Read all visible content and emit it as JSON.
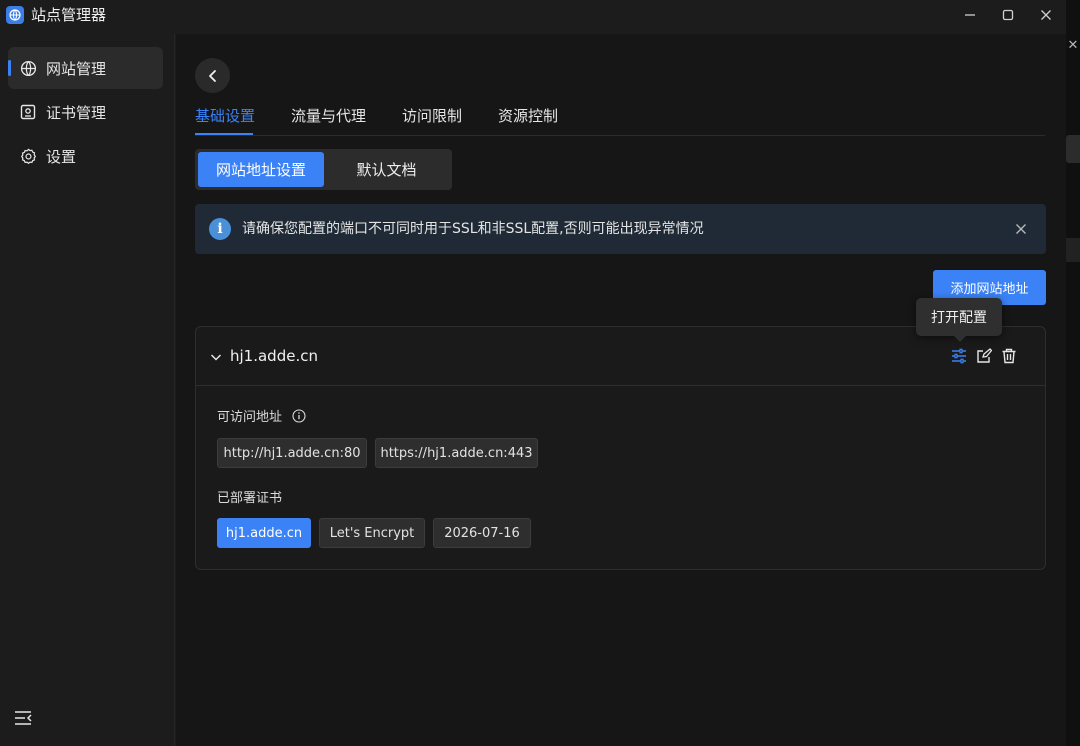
{
  "app": {
    "title": "站点管理器",
    "accent": "#3b82f6"
  },
  "window_controls": {
    "minimize": "minimize-icon",
    "maximize": "maximize-icon",
    "close": "close-icon"
  },
  "sidebar": {
    "items": [
      {
        "label": "网站管理",
        "icon": "globe-icon",
        "active": true
      },
      {
        "label": "证书管理",
        "icon": "certificate-icon",
        "active": false
      },
      {
        "label": "设置",
        "icon": "gear-icon",
        "active": false
      }
    ],
    "collapse_icon": "menu-collapse-icon"
  },
  "main": {
    "tabs": [
      {
        "label": "基础设置",
        "active": true
      },
      {
        "label": "流量与代理",
        "active": false
      },
      {
        "label": "访问限制",
        "active": false
      },
      {
        "label": "资源控制",
        "active": false
      }
    ],
    "segments": [
      {
        "label": "网站地址设置",
        "active": true
      },
      {
        "label": "默认文档",
        "active": false
      }
    ],
    "alert": {
      "text": "请确保您配置的端口不可同时用于SSL和非SSL配置,否则可能出现异常情况",
      "color": "#1f2a36"
    },
    "add_button": "添加网站地址",
    "tooltip": "打开配置",
    "site": {
      "domain": "hj1.adde.cn",
      "accessible_label": "可访问地址",
      "addresses": [
        "http://hj1.adde.cn:80",
        "https://hj1.adde.cn:443"
      ],
      "cert_label": "已部署证书",
      "cert": {
        "domain": "hj1.adde.cn",
        "issuer": "Let's Encrypt",
        "expires": "2026-07-16"
      }
    }
  }
}
